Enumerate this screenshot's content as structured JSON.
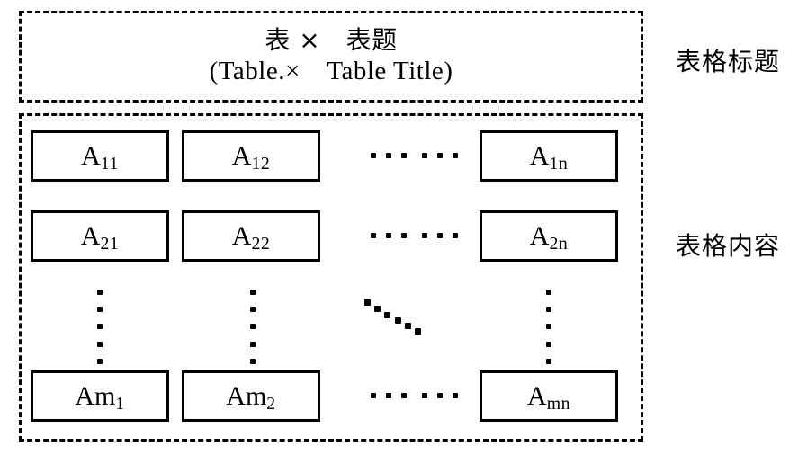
{
  "diagram": {
    "title_block": {
      "line_cn": "表 ×　表题",
      "line_en": "(Table.×　Table Title)"
    },
    "side_labels": {
      "caption": "表格标题",
      "content": "表格内容"
    },
    "table": {
      "rows": [
        {
          "cells": [
            "A",
            "A",
            "A"
          ],
          "subs": [
            "11",
            "12",
            "1n"
          ],
          "ellipsis": "… …"
        },
        {
          "cells": [
            "A",
            "A",
            "A"
          ],
          "subs": [
            "21",
            "22",
            "2n"
          ],
          "ellipsis": "… …"
        },
        {
          "cells": [
            "Am",
            "Am",
            "A"
          ],
          "subs": [
            "1",
            "2",
            "mn"
          ],
          "ellipsis": "… …"
        }
      ],
      "cell_labels": {
        "r1c1_base": "A",
        "r1c1_sub": "11",
        "r1c2_base": "A",
        "r1c2_sub": "12",
        "r1c3_base": "A",
        "r1c3_sub": "1n",
        "r2c1_base": "A",
        "r2c1_sub": "21",
        "r2c2_base": "A",
        "r2c2_sub": "22",
        "r2c3_base": "A",
        "r2c3_sub": "2n",
        "r4c1_base": "Am",
        "r4c1_sub": "1",
        "r4c2_base": "Am",
        "r4c2_sub": "2",
        "r4c3_base": "A",
        "r4c3_sub": "mn"
      }
    },
    "colors": {
      "stroke": "#000000",
      "background": "#ffffff"
    }
  }
}
